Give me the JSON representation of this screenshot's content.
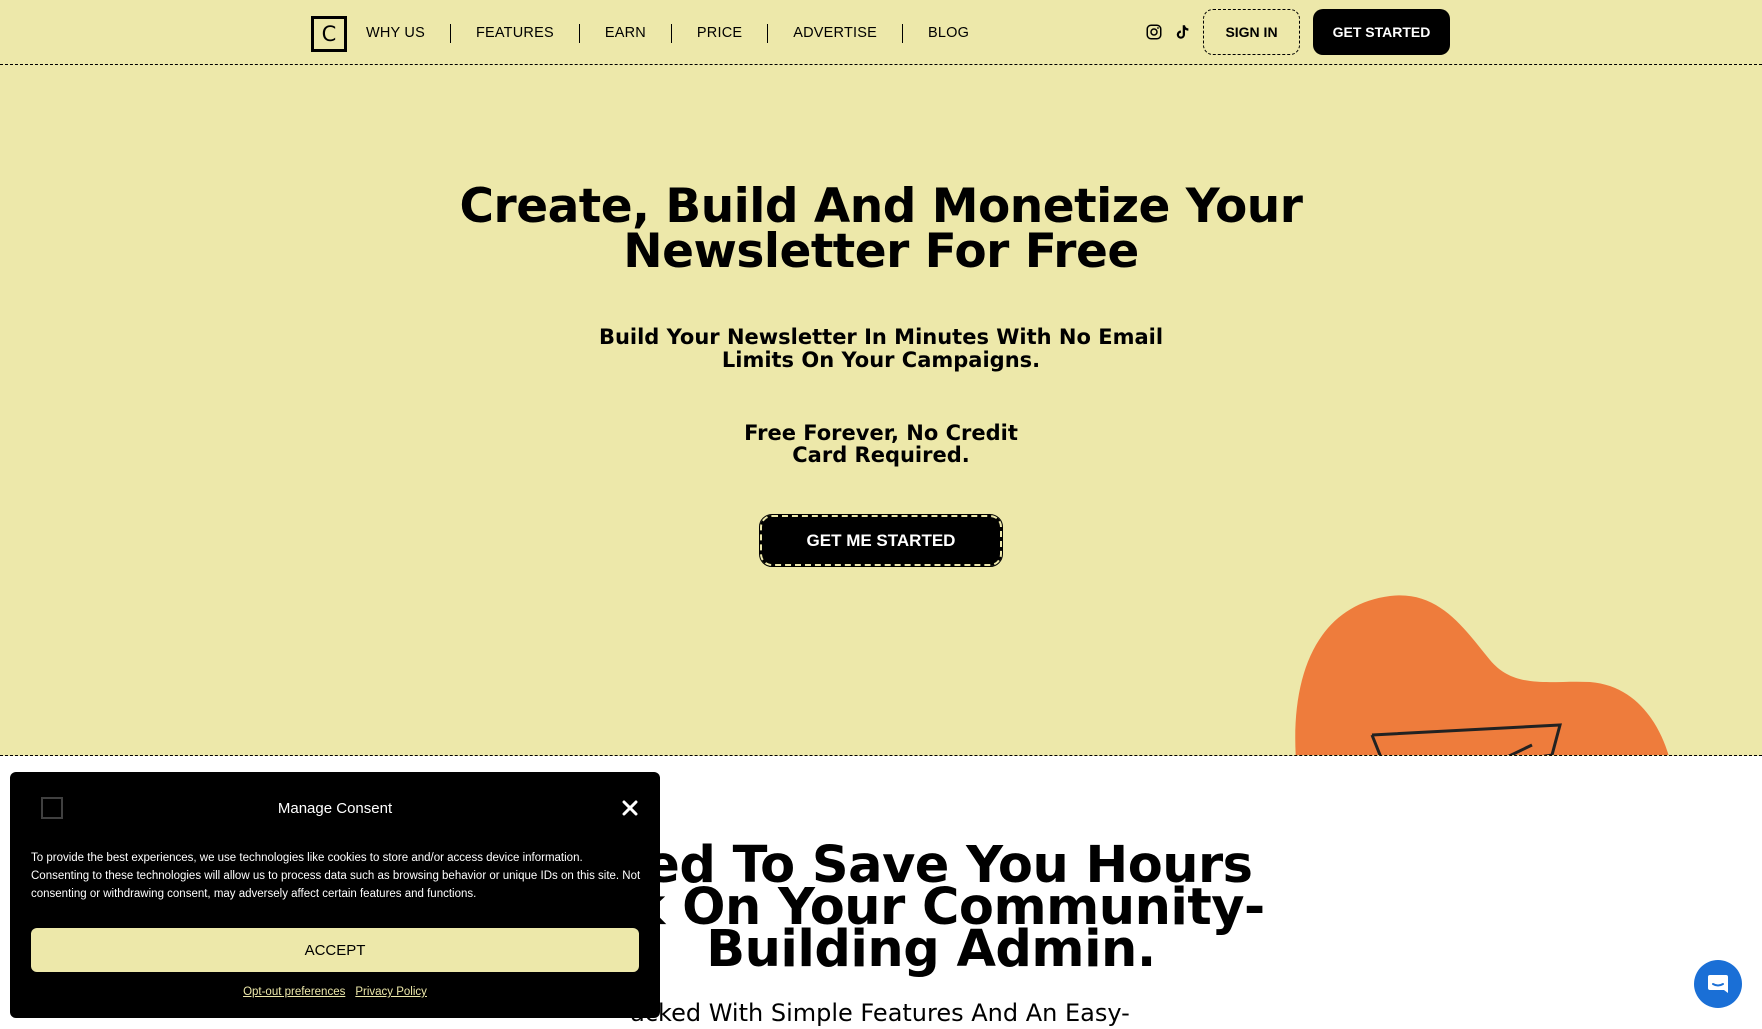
{
  "colors": {
    "hero_bg": "#ede8aa",
    "accent_orange": "#ee7c3c",
    "ink": "#000000",
    "chat_blue": "#1a6fd6"
  },
  "nav": {
    "logo_letter": "C",
    "items": [
      {
        "label": "WHY US"
      },
      {
        "label": "FEATURES"
      },
      {
        "label": "EARN"
      },
      {
        "label": "PRICE"
      },
      {
        "label": "ADVERTISE"
      },
      {
        "label": "BLOG"
      }
    ],
    "social_icons": [
      "instagram-icon",
      "tiktok-icon"
    ],
    "sign_in_label": "SIGN IN",
    "get_started_label": "GET STARTED"
  },
  "hero": {
    "title": "Create, Build And Monetize Your Newsletter For Free",
    "subtitle": "Build Your Newsletter In Minutes With No Email Limits On Your Campaigns.",
    "note": "Free Forever, No Credit Card Required.",
    "cta_label": "GET ME STARTED"
  },
  "section": {
    "title_visible": "ned To Save You Hours ek On Your Community- Building Admin.",
    "subtitle_visible": "acked With Simple Features And An Easy-"
  },
  "consent": {
    "title": "Manage Consent",
    "text": "To provide the best experiences, we use technologies like cookies to store and/or access device information. Consenting to these technologies will allow us to process data such as browsing behavior or unique IDs on this site. Not consenting or withdrawing consent, may adversely affect certain features and functions.",
    "accept_label": "ACCEPT",
    "optout_label": "Opt-out preferences",
    "privacy_label": "Privacy Policy"
  },
  "chat": {
    "icon": "chat-bubble-icon"
  }
}
